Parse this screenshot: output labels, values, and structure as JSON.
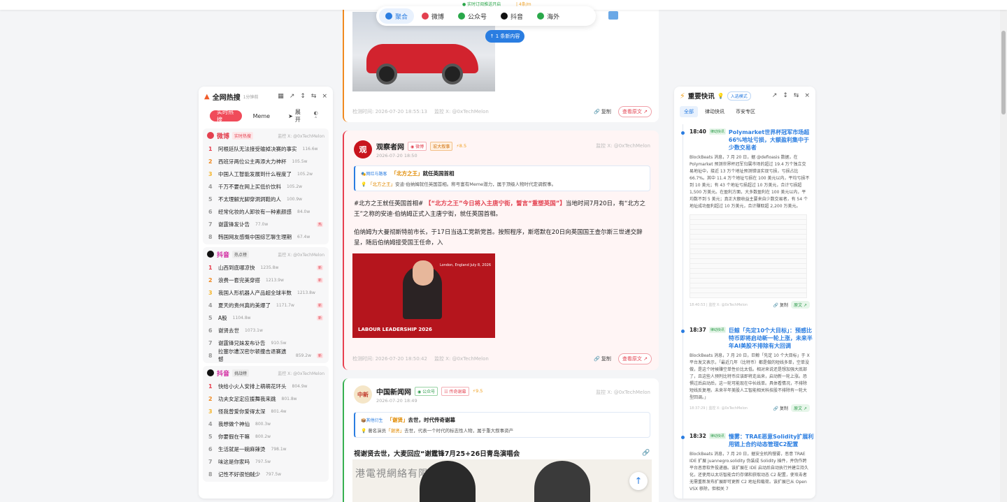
{
  "topbar": {
    "banner": "● 实时订阅推送开启",
    "banner2": "| 4条/m"
  },
  "nav": {
    "tabs": [
      {
        "label": "聚合",
        "icon": "aggregate-icon",
        "color": "#2a7de1",
        "active": true
      },
      {
        "label": "微博",
        "icon": "weibo-icon",
        "color": "#e3404f"
      },
      {
        "label": "公众号",
        "icon": "wechat-icon",
        "color": "#2aa84a"
      },
      {
        "label": "抖音",
        "icon": "douyin-icon",
        "color": "#111111"
      },
      {
        "label": "海外",
        "icon": "overseas-icon",
        "color": "#2aa84a"
      }
    ],
    "new_content": "↑ 1 条新内容"
  },
  "left": {
    "title": "全网热搜",
    "subtitle": "1分钟前",
    "tabs": {
      "hot": "实时热搜",
      "meme": "Meme",
      "expand": "展开"
    },
    "sections": [
      {
        "name": "微博",
        "tag": "实时热搜",
        "monitor": "监控 X: @0xTechMelon",
        "items": [
          {
            "rank": "1",
            "title": "阿根廷队无法接受输掉决赛的事实",
            "heat": "116.6w",
            "badge": ""
          },
          {
            "rank": "2",
            "title": "西班牙两位公主再添大力神杯",
            "heat": "105.5w",
            "badge": ""
          },
          {
            "rank": "3",
            "title": "中国人工智能发展到什么程度了",
            "heat": "105.2w",
            "badge": ""
          },
          {
            "rank": "4",
            "title": "千万不要在网上买低价饮料",
            "heat": "105.2w",
            "badge": ""
          },
          {
            "rank": "5",
            "title": "不太理解光脚穿洞洞鞋的人",
            "heat": "100.9w",
            "badge": ""
          },
          {
            "rank": "6",
            "title": "经常化妆的人卸妆有一种素颜感",
            "heat": "84.0w",
            "badge": ""
          },
          {
            "rank": "7",
            "title": "谢霆锋发讣告",
            "heat": "77.0w",
            "badge": "热"
          },
          {
            "rank": "8",
            "title": "韩国网友感慨中国综艺聊生理期",
            "heat": "67.4w",
            "badge": ""
          }
        ]
      },
      {
        "name": "抖音",
        "tag": "热点榜",
        "monitor": "监控 X: @0xTechMelon",
        "items": [
          {
            "rank": "1",
            "title": "山西到底哪凉快",
            "heat": "1235.8w",
            "badge": "新"
          },
          {
            "rank": "2",
            "title": "浪费一套完美穿搭",
            "heat": "1213.9w",
            "badge": "新"
          },
          {
            "rank": "3",
            "title": "我国人形机器人产品超全球半数",
            "heat": "1213.8w",
            "badge": ""
          },
          {
            "rank": "4",
            "title": "夏天的贵州真的美爆了",
            "heat": "1171.7w",
            "badge": "新"
          },
          {
            "rank": "5",
            "title": "A股",
            "heat": "1104.8w",
            "badge": "新"
          },
          {
            "rank": "6",
            "title": "谢贤去世",
            "heat": "1073.1w",
            "badge": ""
          },
          {
            "rank": "7",
            "title": "谢霆锋兄妹发布讣告",
            "heat": "910.5w",
            "badge": ""
          },
          {
            "rank": "8",
            "title": "拉塞尔遭汉密尔顿撞击退赛遗憾",
            "heat": "859.2w",
            "badge": "新"
          }
        ]
      },
      {
        "name": "抖音",
        "tag": "挑战榜",
        "monitor": "监控 X: @0xTechMelon",
        "items": [
          {
            "rank": "1",
            "title": "快给小火人安排上萌萌花环头",
            "heat": "804.9w",
            "badge": ""
          },
          {
            "rank": "2",
            "title": "功夫女足定应援舞我来跳",
            "heat": "801.8w",
            "badge": ""
          },
          {
            "rank": "3",
            "title": "怪我曾爱你爱得太深",
            "heat": "801.4w",
            "badge": ""
          },
          {
            "rank": "4",
            "title": "我想做个神仙",
            "heat": "800.3w",
            "badge": ""
          },
          {
            "rank": "5",
            "title": "你要假在干嘛",
            "heat": "800.2w",
            "badge": ""
          },
          {
            "rank": "6",
            "title": "生活就是一碗麻辣烫",
            "heat": "798.1w",
            "badge": ""
          },
          {
            "rank": "7",
            "title": "味这是你家吗",
            "heat": "797.5w",
            "badge": ""
          },
          {
            "rank": "8",
            "title": "记性不好很怕贼少",
            "heat": "797.5w",
            "badge": ""
          }
        ]
      }
    ]
  },
  "feed": {
    "card1": {
      "time": "检测时间: 2026-07-20 18:55:13",
      "monitor": "监控 X: @0xTechMelon",
      "copy": "复制",
      "view": "查看原文 ↗"
    },
    "card2": {
      "name": "观察者网",
      "time": "2026-07-20 18:50",
      "platform": "微博",
      "tag": "宏大叙事",
      "score": "⚡8.5",
      "monitor": "监控 X: @0xTechMelon",
      "box_kind": "🎭网红与路客",
      "box_title_q": "「北方之王」",
      "box_title": "就任英国首相",
      "box_desc_q": "「北方之王」",
      "box_desc": "安迪·伯纳姆就任英国首相。称号富有Meme潜力，属于顶级人物时代定调叙事。",
      "p1_a": "#北方之王就任英国首相# ",
      "p1_b": "【“北方之王”今日将入主唐宁街，誓言“重塑英国”】",
      "p1_c": "当地时间7月20日，有“北方之王”之称的安迪·伯纳姆正式入主唐宁街，就任英国首相。",
      "p2": "伯纳姆为大曼彻斯特前市长，于17日当选工党新党首。按照程序，斯塔默在20日向英国国王查尔斯三世递交辞呈，随后伯纳姆接受国王任命，入",
      "photo_label": "LABOUR LEADERSHIP 2026",
      "photo_loc": "London, England July 8, 2026",
      "foot_time": "检测时间: 2026-07-20 18:50:42",
      "foot_monitor": "监控 X: @0xTechMelon",
      "copy": "复制",
      "view": "查看原文 ↗"
    },
    "card3": {
      "name": "中国新闻网",
      "time": "2026-07-20 18:49",
      "platform": "公众号",
      "tag": "传奇谢幕",
      "score": "⚡9.5",
      "monitor": "监控 X: @0xTechMelon",
      "box_kind": "📦其他衍生",
      "box_title_q": "「谢贤」",
      "box_title": "去世，时代传奇谢幕",
      "box_desc_q": "「谢贤」",
      "box_desc": "去世，代表一个时代的标志性人物，属于重大叙事资产",
      "box_desc_pre": "著名演员",
      "video_title": "视谢贤去世，大麦回应“谢霆锋7月25+26日青岛演唱会",
      "video_text": "港電視網絡有限"
    }
  },
  "right": {
    "title": "重要快讯",
    "mode": "入选模式",
    "tabs": [
      {
        "label": "全部",
        "active": true
      },
      {
        "label": "律动快讯"
      },
      {
        "label": "币安专区"
      }
    ],
    "news": [
      {
        "time": "18:40",
        "tag": "律动快讯",
        "headline": "Polymarket世界杯冠军市场超66%地址亏损，大额盈利集中于少数交易者",
        "body": "BlockBeats 消息，7 月 20 日，据 @defioasis 数据，在 Polymarket 预测世界杯冠军归属市场的超过 19.4 万个独立交易地址中，接近 13 万个地址预测错误实现亏损，亏损占比 66.7%。其中 11.4 万个地址亏损在 100 美元以内，平均亏损不到 10 美元；有 43 个地址亏损超过 10 万美元，合计亏损超 1,500 万美元。在盈利方面，大多数盈利在 100 美元以内，平均数不到 5 美元；真正大额收益主要来自少数交易者，有 54 个地址成功盈利超过 10 万美元，合计赚取超 2,200 万美元。",
        "stamp": "18:40:53 | 监控 X: @0xTechMelon",
        "copy": "复制",
        "orig": "原文 ↗"
      },
      {
        "time": "18:37",
        "tag": "律动快讯",
        "headline": "巨鲸「先定10个大目标」：预感比特币即将启动新一轮上涨，未来半年AI美股不排除有大回调",
        "body": "BlockBeats 消息，7 月 20 日，巨鲸「先定 10 个大目标」于 X 平台发文表示，「最近几年（比特币）都是做的短线多单，空单没做，是这个时候赚空单性价比太低。相对来说还是想加强大底部了，且这些人预判比特币应该即将走出来，启动新一轮上涨。恐惧过后启动后，这一轮可能现在中长线单。具体看情况，不排除短线反复埋。未来半年美股人工智能相关科技股不排除有一轮大型回调。」",
        "stamp": "18:37:29 | 监控 X: @0xTechMelon",
        "copy": "复制",
        "orig": "原文 ↗"
      },
      {
        "time": "18:32",
        "tag": "律动快讯",
        "headline": "慢雾：TRAE恶意Solidity扩展利用链上合约动态管理C2配置",
        "body": "BlockBeats 消息，7 月 20 日，据安全机构慢雾，恶意 TRAE IDE 扩展 juannegro.solidity 伪装成 Solidity 插件，并伪作跨平台恶意软件投递器。该扩展在 IDE 启动后自动执行并建立持久化，还使用以太坊智能合约存储和获取动态 C2 配置，使攻击者无需重新发布扩展即可更新 C2 地址和载荷。该扩展已从 Open VSX 移除，但相关 7"
      }
    ]
  }
}
